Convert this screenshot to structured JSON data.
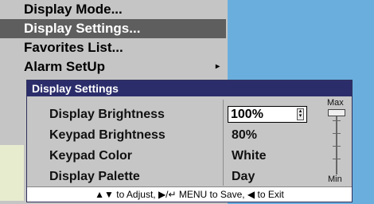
{
  "menu": {
    "items": [
      {
        "label": "Display Mode..."
      },
      {
        "label": "Display Settings..."
      },
      {
        "label": "Favorites List..."
      },
      {
        "label": "Alarm SetUp"
      }
    ],
    "submenu_arrow": "▸"
  },
  "dialog": {
    "title": "Display Settings",
    "rows": [
      {
        "label": "Display Brightness",
        "value": "100%"
      },
      {
        "label": "Keypad Brightness",
        "value": "80%"
      },
      {
        "label": "Keypad Color",
        "value": "White"
      },
      {
        "label": "Display Palette",
        "value": "Day"
      }
    ],
    "slider": {
      "max_label": "Max",
      "min_label": "Min",
      "level": 1.0
    },
    "help": "▲▼ to Adjust, ▶/↵ MENU to Save, ◀ to Exit"
  },
  "colors": {
    "title_bar": "#2b2d6b",
    "dialog_bg": "#c6c6c6",
    "selected_menu": "#5e5e5e",
    "background_blue": "#6aaedd"
  }
}
